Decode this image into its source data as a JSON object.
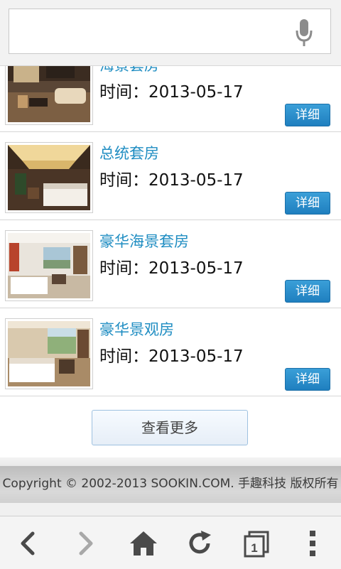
{
  "search": {
    "placeholder": "",
    "mic_icon": "microphone-icon"
  },
  "items": [
    {
      "title": "海景套房",
      "time": "时间：2013-05-17",
      "button": "详细",
      "thumb": "room-photo-1"
    },
    {
      "title": "总统套房",
      "time": "时间：2013-05-17",
      "button": "详细",
      "thumb": "room-photo-2"
    },
    {
      "title": "豪华海景套房",
      "time": "时间：2013-05-17",
      "button": "详细",
      "thumb": "room-photo-3"
    },
    {
      "title": "豪华景观房",
      "time": "时间：2013-05-17",
      "button": "详细",
      "thumb": "room-photo-4"
    }
  ],
  "more_button": "查看更多",
  "footer": {
    "copyright": "Copyright © 2002-2013 SOOKIN.COM. 手趣科技 版权所有"
  },
  "nav": {
    "back_icon": "back-arrow-icon",
    "forward_icon": "forward-arrow-icon",
    "home_icon": "home-icon",
    "reload_icon": "reload-icon",
    "tabs_icon": "tabs-icon",
    "tabs_count": "1",
    "menu_icon": "overflow-menu-icon"
  },
  "colors": {
    "title": "#1f8dc2",
    "button": "#1f7fbf"
  }
}
